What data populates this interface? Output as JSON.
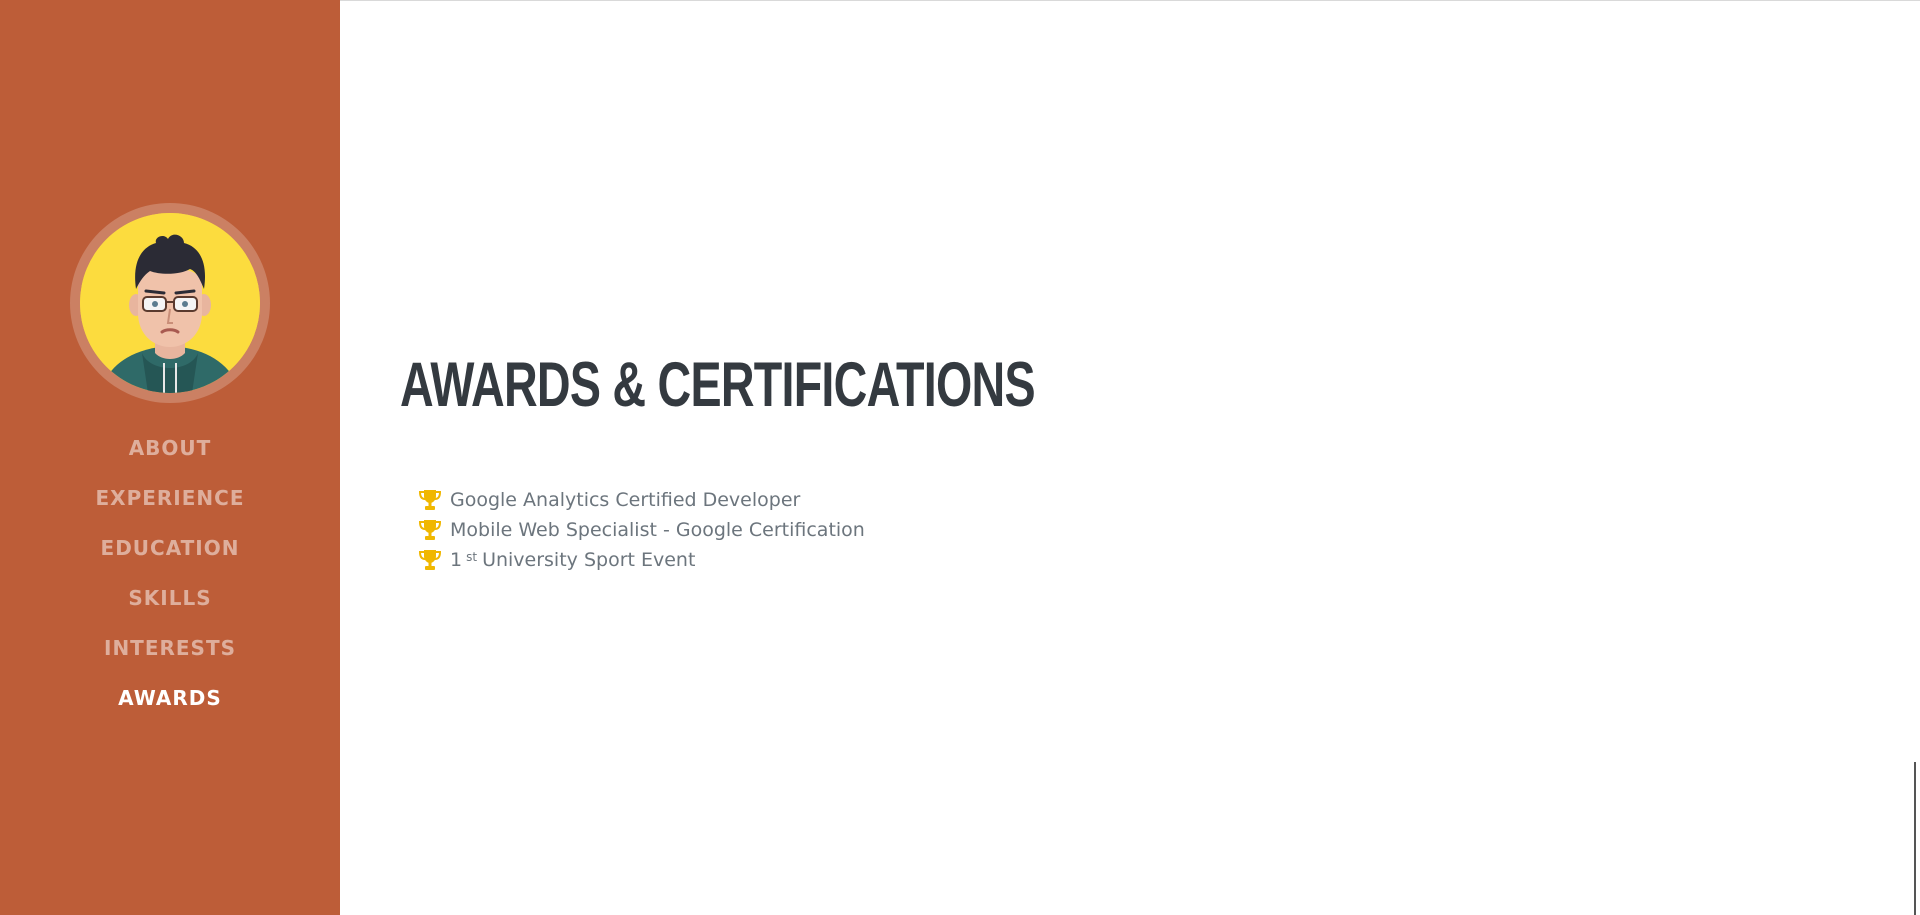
{
  "sidebar": {
    "avatar_alt": "profile avatar",
    "nav": [
      {
        "label": "ABOUT",
        "active": false
      },
      {
        "label": "EXPERIENCE",
        "active": false
      },
      {
        "label": "EDUCATION",
        "active": false
      },
      {
        "label": "SKILLS",
        "active": false
      },
      {
        "label": "INTERESTS",
        "active": false
      },
      {
        "label": "AWARDS",
        "active": true
      }
    ]
  },
  "main": {
    "title": "AWARDS & CERTIFICATIONS",
    "awards": [
      {
        "text": "Google Analytics Certified Developer",
        "icon": "trophy-icon"
      },
      {
        "text": "Mobile Web Specialist - Google Certification",
        "icon": "trophy-icon"
      },
      {
        "prefix": "1",
        "sup": "st",
        "suffix": "University Sport Event",
        "icon": "trophy-icon"
      }
    ]
  },
  "colors": {
    "sidebar_bg": "#bd5d38",
    "title": "#343a40",
    "text": "#6c757d",
    "trophy": "#f0b700",
    "avatar_bg": "#fcdc3e"
  }
}
